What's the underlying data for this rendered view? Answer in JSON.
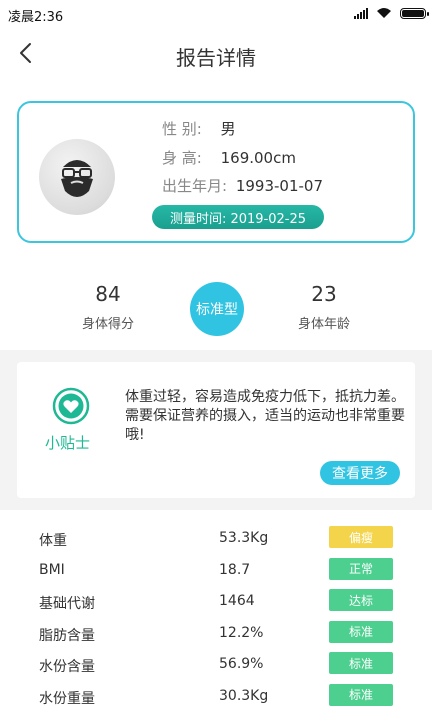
{
  "status_bar": {
    "time": "凌晨2:36"
  },
  "header": {
    "title": "报告详情"
  },
  "profile": {
    "gender_label": "性  别:",
    "gender_value": "男",
    "height_label": "身  高:",
    "height_value": "169.00cm",
    "birth_label": "出生年月:",
    "birth_value": "1993-01-07",
    "measure_time": "测量时间: 2019-02-25"
  },
  "stats": {
    "score_value": "84",
    "score_label": "身体得分",
    "body_type": "标准型",
    "age_value": "23",
    "age_label": "身体年龄"
  },
  "tips": {
    "label": "小贴士",
    "text": "体重过轻，容易造成免疫力低下，抵抗力差。需要保证营养的摄入，适当的运动也非常重要哦!",
    "more_button": "查看更多"
  },
  "metrics": [
    {
      "name": "体重",
      "value": "53.3Kg",
      "status": "偏瘦",
      "color": "#f3d44a"
    },
    {
      "name": "BMI",
      "value": "18.7",
      "status": "正常",
      "color": "#4dd08f"
    },
    {
      "name": "基础代谢",
      "value": "1464",
      "status": "达标",
      "color": "#4dd08f"
    },
    {
      "name": "脂肪含量",
      "value": "12.2%",
      "status": "标准",
      "color": "#4dd08f"
    },
    {
      "name": "水份含量",
      "value": "56.9%",
      "status": "标准",
      "color": "#4dd08f"
    },
    {
      "name": "水份重量",
      "value": "30.3Kg",
      "status": "标准",
      "color": "#4dd08f"
    }
  ],
  "colors": {
    "accent": "#31c4e2",
    "card_border": "#3cc6dd",
    "pill": "#1fae9c",
    "tips_green": "#1fb894"
  },
  "icons": {
    "back": "chevron-left-icon",
    "signal": "signal-icon",
    "wifi": "wifi-icon",
    "battery": "battery-icon",
    "avatar": "avatar-beard-icon",
    "tips": "heart-icon"
  }
}
